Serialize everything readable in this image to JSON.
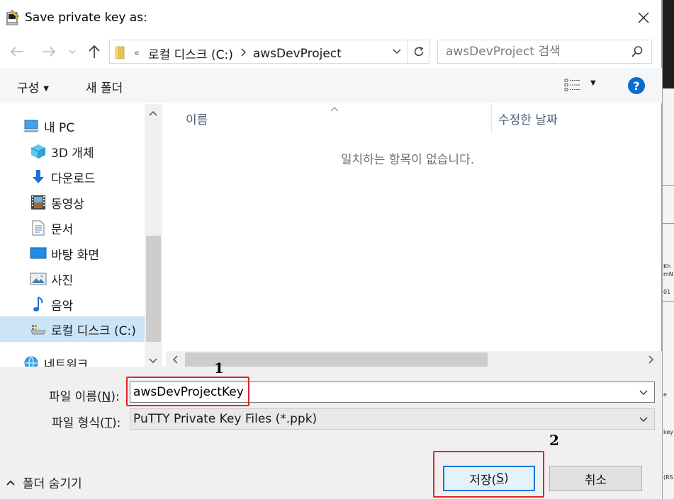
{
  "window": {
    "title": "Save private key as:"
  },
  "address": {
    "crumbs": [
      "로컬 디스크 (C:)",
      "awsDevProject"
    ],
    "overflow": "«"
  },
  "search": {
    "placeholder": "awsDevProject 검색"
  },
  "toolbar": {
    "organize": "구성",
    "new_folder": "새 폴더"
  },
  "nav": {
    "items": [
      {
        "label": "내 PC",
        "icon": "pc-icon"
      },
      {
        "label": "3D 개체",
        "icon": "3d-objects-icon"
      },
      {
        "label": "다운로드",
        "icon": "download-icon"
      },
      {
        "label": "동영상",
        "icon": "video-icon"
      },
      {
        "label": "문서",
        "icon": "document-icon"
      },
      {
        "label": "바탕 화면",
        "icon": "desktop-icon"
      },
      {
        "label": "사진",
        "icon": "pictures-icon"
      },
      {
        "label": "음악",
        "icon": "music-icon"
      },
      {
        "label": "로컬 디스크 (C:)",
        "icon": "drive-icon",
        "selected": true
      },
      {
        "label": "네트워크",
        "icon": "network-icon"
      }
    ]
  },
  "list": {
    "columns": [
      "이름",
      "수정한 날짜"
    ],
    "empty_message": "일치하는 항목이 없습니다."
  },
  "form": {
    "filename_label": "파일 이름(",
    "filename_key": "N",
    "filename_label_end": "):",
    "filename_value": "awsDevProjectKey",
    "filetype_label": "파일 형식(",
    "filetype_key": "T",
    "filetype_label_end": "):",
    "filetype_value": "PuTTY Private Key Files (*.ppk)"
  },
  "buttons": {
    "save": "저장(",
    "save_key": "S",
    "save_end": ")",
    "cancel": "취소",
    "hide_folders": "폴더 숨기기"
  },
  "annotations": {
    "step1": "1",
    "step2": "2"
  },
  "background_fragments": [
    "Kh",
    "mN",
    "01",
    "e",
    "key",
    "(RS"
  ],
  "colors": {
    "accent": "#0078d7",
    "selection": "#cce4f7",
    "highlight_box": "#e0242b",
    "help": "#0a6cd1"
  }
}
